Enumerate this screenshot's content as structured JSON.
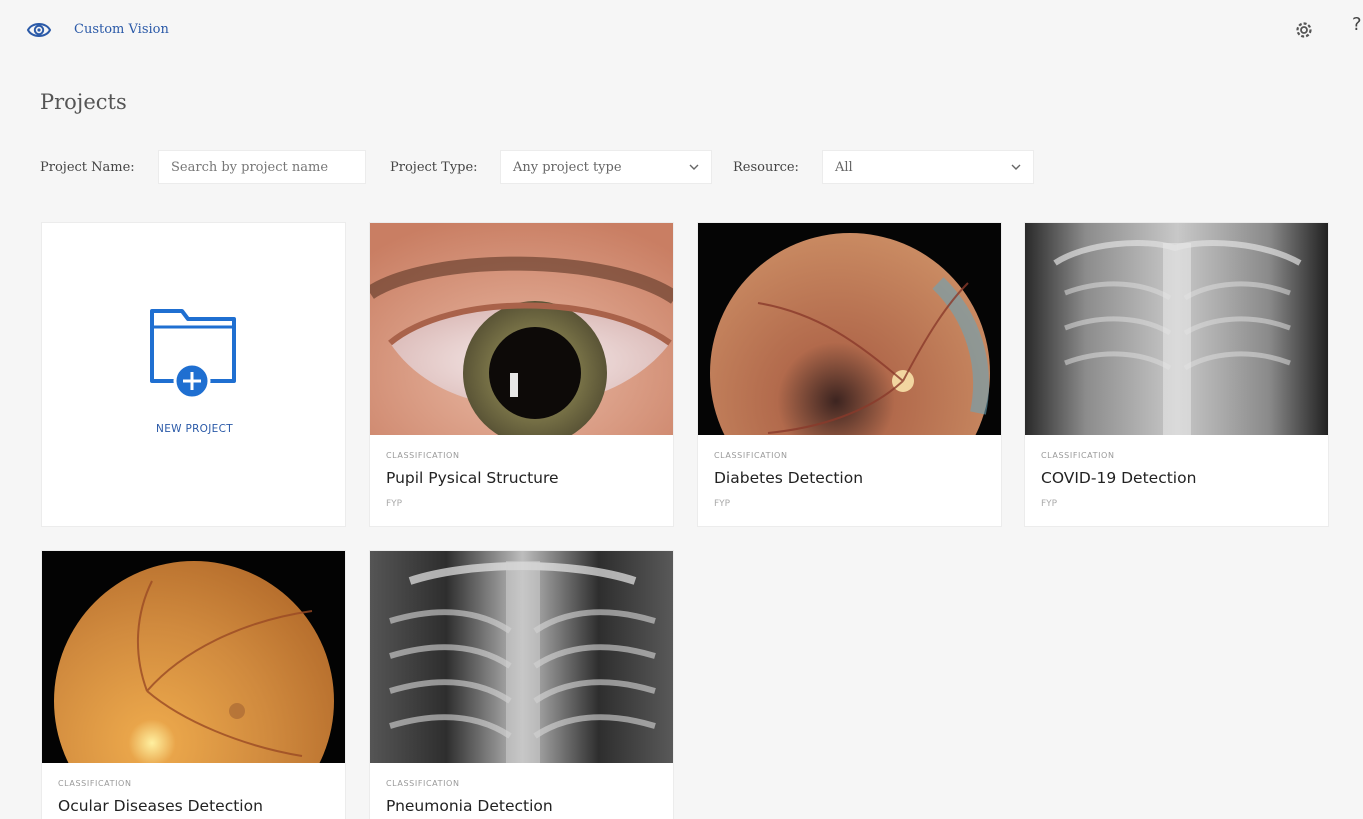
{
  "app": {
    "brand": "Custom Vision"
  },
  "page": {
    "title": "Projects"
  },
  "filters": {
    "name_label": "Project Name:",
    "name_placeholder": "Search by project name",
    "type_label": "Project Type:",
    "type_value": "Any project type",
    "resource_label": "Resource:",
    "resource_value": "All"
  },
  "new_project": {
    "label": "NEW PROJECT"
  },
  "projects": [
    {
      "type": "CLASSIFICATION",
      "name": "Pupil Pysical Structure",
      "resource": "FYP"
    },
    {
      "type": "CLASSIFICATION",
      "name": "Diabetes Detection",
      "resource": "FYP"
    },
    {
      "type": "CLASSIFICATION",
      "name": "COVID-19 Detection",
      "resource": "FYP"
    },
    {
      "type": "CLASSIFICATION",
      "name": "Ocular Diseases Detection"
    },
    {
      "type": "CLASSIFICATION",
      "name": "Pneumonia Detection"
    }
  ],
  "icons": {
    "logo": "eye-icon",
    "settings": "gear-icon",
    "new_project": "folder-add-icon",
    "dropdown": "chevron-down-icon"
  },
  "colors": {
    "accent": "#2b5aa8",
    "new_project_icon": "#1f6fd1"
  }
}
